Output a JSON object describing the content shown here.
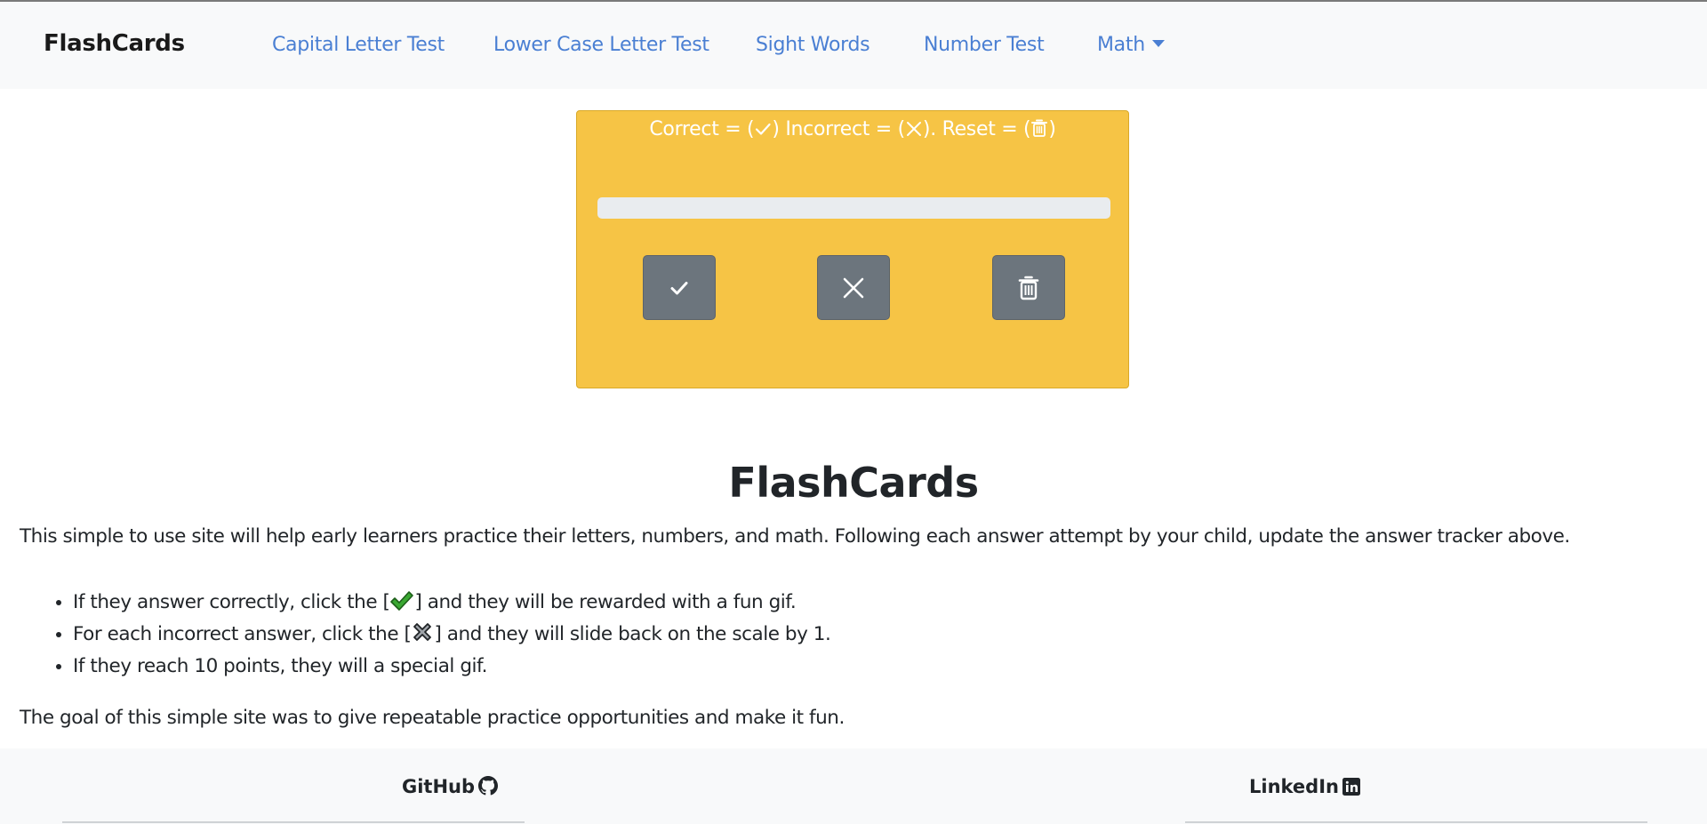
{
  "navbar": {
    "brand": "FlashCards",
    "links": [
      {
        "label": "Capital Letter Test"
      },
      {
        "label": "Lower Case Letter Test"
      },
      {
        "label": "Sight Words"
      },
      {
        "label": "Number Test"
      },
      {
        "label": "Math"
      }
    ]
  },
  "tracker": {
    "instruction_correct": "Correct = (",
    "instruction_incorrect": ") Incorrect = (",
    "instruction_reset": "). Reset = (",
    "instruction_end": ")",
    "progress_fraction": 0,
    "buttons": {
      "correct_icon": "check-icon",
      "incorrect_icon": "x-icon",
      "reset_icon": "trash-icon"
    },
    "colors": {
      "card": "#f6c445",
      "button": "#6c757d"
    }
  },
  "main": {
    "title": "FlashCards",
    "intro": "This simple to use site will help early learners practice their letters, numbers, and math. Following each answer attempt by your child, update the answer tracker above.",
    "tips": [
      {
        "before": "If they answer correctly, click the [",
        "icon": "green-check-mark-icon",
        "after": "] and they will be rewarded with a fun gif."
      },
      {
        "before": "For each incorrect answer, click the [",
        "icon": "cross-mark-icon",
        "after": "] and they will slide back on the scale by 1."
      },
      {
        "text": "If they reach 10 points, they will a special gif."
      }
    ],
    "goal": "The goal of this simple site was to give repeatable practice opportunities and make it fun."
  },
  "footer": {
    "github_label": "GitHub",
    "linkedin_label": "LinkedIn"
  }
}
